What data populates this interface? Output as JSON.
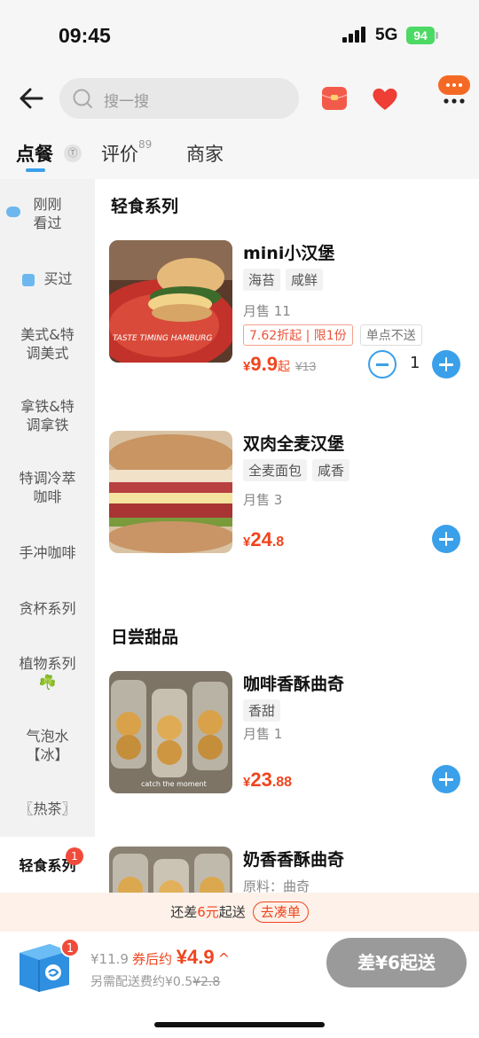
{
  "status_bar": {
    "time": "09:45",
    "network": "5G",
    "battery": "94"
  },
  "header": {
    "search_placeholder": "搜一搜"
  },
  "tabs": [
    {
      "label": "点餐",
      "active": true
    },
    {
      "label": "评价",
      "count": "89"
    },
    {
      "label": "商家"
    }
  ],
  "pin_icon_text": "Ⓣ",
  "sidebar": {
    "items": [
      {
        "label_lines": [
          "刚刚",
          "看过"
        ]
      },
      {
        "label_lines": [
          "买过"
        ]
      },
      {
        "label_lines": [
          "美式&特",
          "调美式"
        ]
      },
      {
        "label_lines": [
          "拿铁&特",
          "调拿铁"
        ]
      },
      {
        "label_lines": [
          "特调冷萃",
          "咖啡"
        ]
      },
      {
        "label_lines": [
          "手冲咖啡"
        ]
      },
      {
        "label_lines": [
          "贪杯系列"
        ]
      },
      {
        "label_lines": [
          "植物系列",
          "☘️"
        ]
      },
      {
        "label_lines": [
          "气泡水",
          "【冰】"
        ]
      },
      {
        "label_lines": [
          "〖热茶〗"
        ]
      },
      {
        "label_lines": [
          "轻食系列"
        ],
        "active": true,
        "badge": "1"
      }
    ]
  },
  "sections": [
    {
      "title": "轻食系列",
      "products": [
        {
          "name": "mini小汉堡",
          "tags": [
            "海苔",
            "咸鲜"
          ],
          "sold": "月售 11",
          "promo": "7.62折起 | 限1份",
          "notice": "单点不送",
          "price_currency": "¥",
          "price_int": "9.9",
          "price_suffix": "起",
          "original_price": "¥13",
          "quantity": "1",
          "image_text": "TASTE TIMING HAMBURG"
        },
        {
          "name": "双肉全麦汉堡",
          "tags": [
            "全麦面包",
            "咸香"
          ],
          "sold": "月售 3",
          "price_currency": "¥",
          "price_int": "24",
          "price_dec": ".8"
        }
      ]
    },
    {
      "title": "日尝甜品",
      "products": [
        {
          "name": "咖啡香酥曲奇",
          "tags": [
            "香甜"
          ],
          "sold": "月售 1",
          "price_currency": "¥",
          "price_int": "23",
          "price_dec": ".88",
          "image_text": "catch the moment"
        },
        {
          "name": "奶香香酥曲奇",
          "ingredients": "原料：曲奇"
        }
      ]
    }
  ],
  "gap_bar": {
    "prefix": "还差",
    "amount": "6元",
    "suffix": "起送",
    "action": "去凑单"
  },
  "cart": {
    "badge": "1",
    "original": "¥11.9",
    "after_label": "券后约",
    "after_price": "¥4.9",
    "chevron": "^",
    "fee_text": "另需配送费约¥0.5",
    "fee_strike": "¥2.8",
    "checkout_label": "差¥6起送"
  },
  "colors": {
    "accent_blue": "#3aa0ea",
    "price_red": "#f0451d",
    "checkout_gray": "#9a9a9a"
  }
}
